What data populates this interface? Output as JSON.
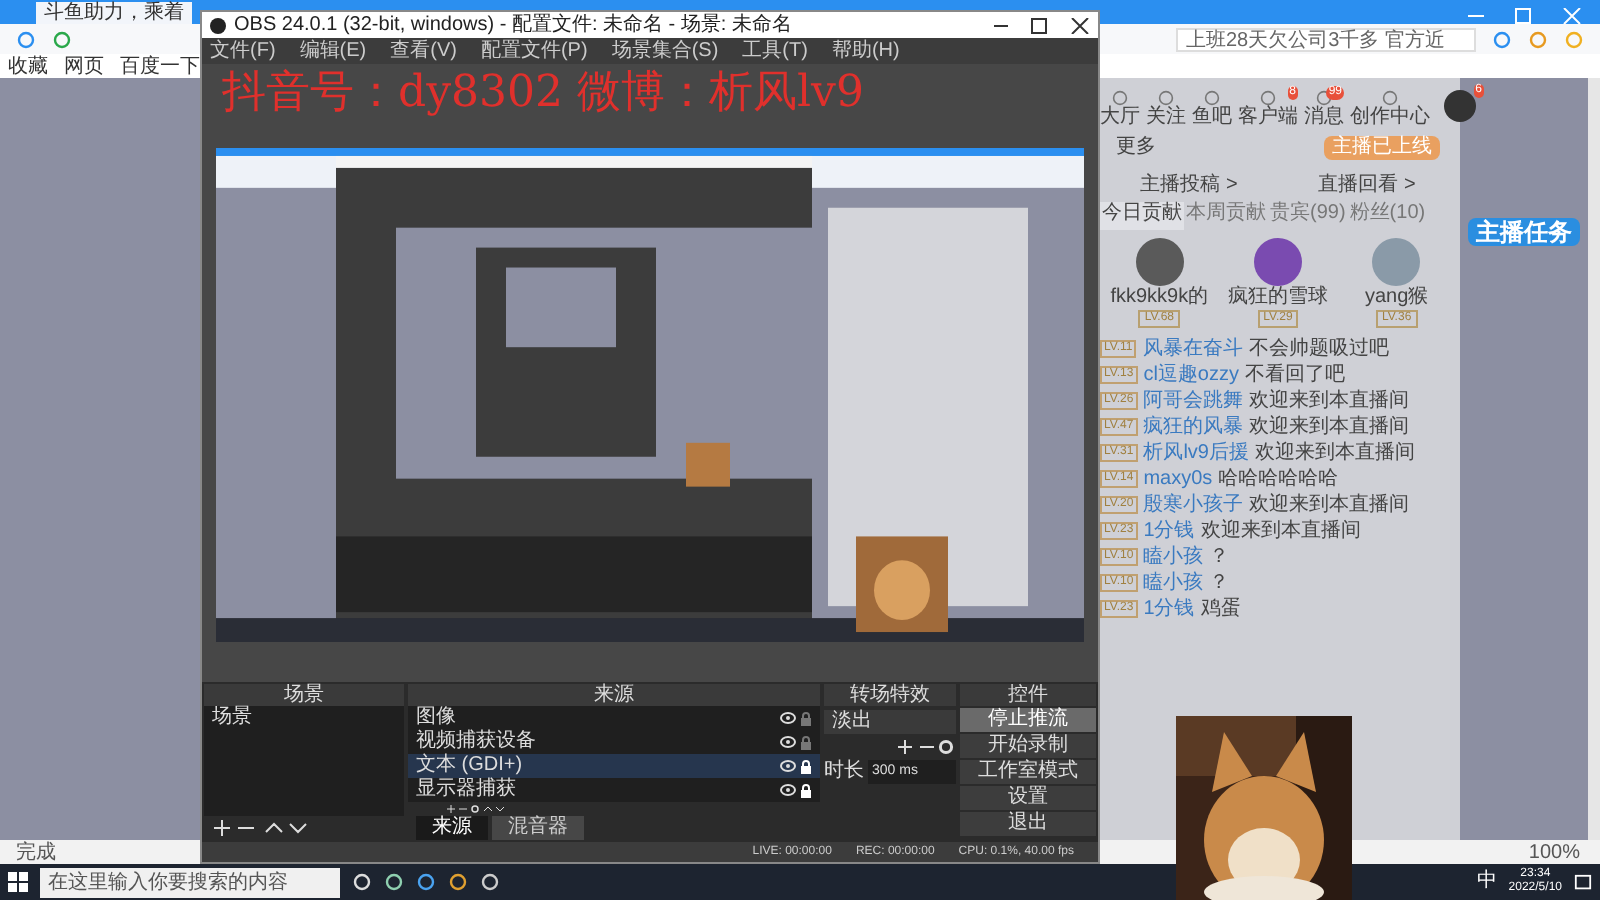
{
  "browser": {
    "tab_title": "斗鱼助力，乘着",
    "search_placeholder": "上班28天欠公司3千多 官方近",
    "bookmarks": [
      "收藏",
      "网页",
      "百度一下"
    ],
    "status": "完成",
    "zoom": "100%"
  },
  "site": {
    "nav": [
      {
        "label": "大厅"
      },
      {
        "label": "关注"
      },
      {
        "label": "鱼吧"
      },
      {
        "label": "客户端",
        "badge": "8"
      },
      {
        "label": "消息",
        "badge": "99"
      },
      {
        "label": "创作中心"
      }
    ],
    "avatar_badge": "6",
    "more": "更多",
    "live_button": "主播已上线",
    "links": [
      "主播投稿 >",
      "直播回看 >"
    ],
    "tabs": [
      {
        "label": "今日贡献",
        "selected": true
      },
      {
        "label": "本周贡献",
        "selected": false
      },
      {
        "label": "贵宾(99)",
        "selected": false
      },
      {
        "label": "粉丝(10)",
        "selected": false
      }
    ],
    "top3": [
      {
        "name": "fkk9kk9k的",
        "level": "LV.68",
        "color": "#5a5a5a"
      },
      {
        "name": "疯狂的雪球",
        "level": "LV.29",
        "color": "#7a4bb0"
      },
      {
        "name": "yang猴",
        "level": "LV.36",
        "color": "#8a9aa8"
      }
    ],
    "chat": [
      {
        "level": "LV.11",
        "name": "风暴在奋斗",
        "message": "不会帅题吸过吧"
      },
      {
        "level": "LV.13",
        "name": "cl逗趣ozzy",
        "message": "不看回了吧"
      },
      {
        "level": "LV.26",
        "name": "阿哥会跳舞",
        "message": "欢迎来到本直播间"
      },
      {
        "level": "LV.47",
        "name": "疯狂的风暴",
        "message": "欢迎来到本直播间"
      },
      {
        "level": "LV.31",
        "name": "析风lv9后援",
        "message": "欢迎来到本直播间"
      },
      {
        "level": "LV.14",
        "name": "maxy0s",
        "message": "哈哈哈哈哈哈"
      },
      {
        "level": "LV.20",
        "name": "殷寒小孩子",
        "message": "欢迎来到本直播间"
      },
      {
        "level": "LV.23",
        "name": "1分钱",
        "message": "欢迎来到本直播间"
      },
      {
        "level": "LV.10",
        "name": "瞌小孩",
        "message": "？"
      },
      {
        "level": "LV.10",
        "name": "瞌小孩",
        "message": "？"
      },
      {
        "level": "LV.23",
        "name": "1分钱",
        "message": "鸡蛋"
      }
    ],
    "task_badge": "主播任务"
  },
  "obs": {
    "title": "OBS 24.0.1 (32-bit, windows) - 配置文件: 未命名 - 场景: 未命名",
    "menu": [
      "文件(F)",
      "编辑(E)",
      "查看(V)",
      "配置文件(P)",
      "场景集合(S)",
      "工具(T)",
      "帮助(H)"
    ],
    "overlay_text": "抖音号：dy8302  微博：析风lv9",
    "scenes": {
      "title": "场景",
      "items": [
        {
          "label": "场景",
          "selected": false
        }
      ]
    },
    "sources": {
      "title": "来源",
      "items": [
        {
          "label": "图像",
          "selected": false,
          "locked": false
        },
        {
          "label": "视频捕获设备",
          "selected": false,
          "locked": false
        },
        {
          "label": "文本 (GDI+)",
          "selected": true,
          "locked": true
        },
        {
          "label": "显示器捕获",
          "selected": false,
          "locked": true
        }
      ],
      "tabs": [
        {
          "label": "来源",
          "selected": true
        },
        {
          "label": "混音器",
          "selected": false
        }
      ]
    },
    "transitions": {
      "title": "转场特效",
      "value": "淡出",
      "duration_label": "时长",
      "duration": "300 ms"
    },
    "controls": {
      "title": "控件",
      "buttons": [
        {
          "label": "停止推流",
          "active": true
        },
        {
          "label": "开始录制",
          "active": false
        },
        {
          "label": "工作室模式",
          "active": false
        },
        {
          "label": "设置",
          "active": false
        },
        {
          "label": "退出",
          "active": false
        }
      ]
    },
    "status": [
      "LIVE: 00:00:00",
      "REC: 00:00:00",
      "CPU: 0.1%, 40.00 fps"
    ]
  },
  "taskbar": {
    "search_placeholder": "在这里输入你要搜索的内容",
    "ime": "中",
    "time": "23:34",
    "date": "2022/5/10"
  }
}
